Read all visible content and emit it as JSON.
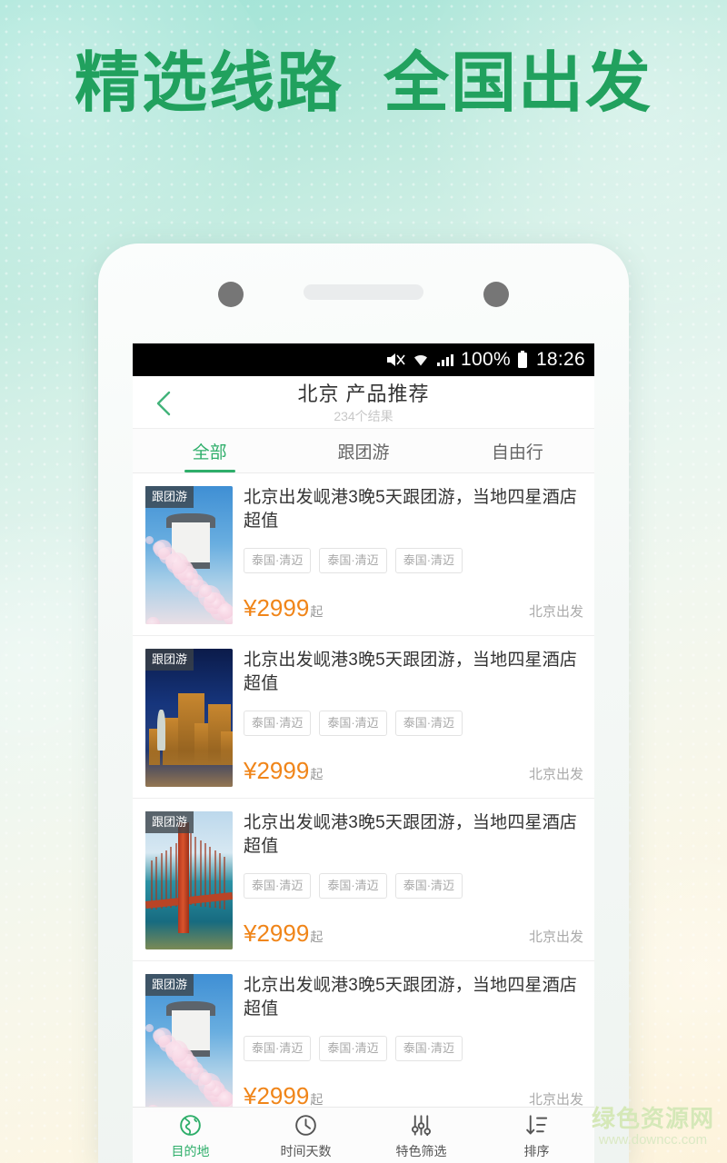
{
  "promo": {
    "headline": "精选线路  全国出发"
  },
  "status_bar": {
    "mute_icon": "mute-icon",
    "wifi_icon": "wifi-icon",
    "signal_icon": "signal-icon",
    "battery_percent": "100%",
    "battery_icon": "battery-icon",
    "time": "18:26"
  },
  "header": {
    "back_icon": "back-chevron-icon",
    "title": "北京 产品推荐",
    "result_count": "234个结果"
  },
  "tabs": [
    {
      "label": "全部",
      "active": true
    },
    {
      "label": "跟团游",
      "active": false
    },
    {
      "label": "自由行",
      "active": false
    }
  ],
  "products": [
    {
      "badge": "跟团游",
      "title": "北京出发岘港3晚5天跟团游，当地四星酒店超值",
      "tags": [
        "泰国·清迈",
        "泰国·清迈",
        "泰国·清迈"
      ],
      "price_symbol": "¥",
      "price": "2999",
      "price_suffix": "起",
      "depart": "北京出发",
      "image": "cherry-blossom-castle"
    },
    {
      "badge": "跟团游",
      "title": "北京出发岘港3晚5天跟团游，当地四星酒店超值",
      "tags": [
        "泰国·清迈",
        "泰国·清迈",
        "泰国·清迈"
      ],
      "price_symbol": "¥",
      "price": "2999",
      "price_suffix": "起",
      "depart": "北京出发",
      "image": "las-vegas-night"
    },
    {
      "badge": "跟团游",
      "title": "北京出发岘港3晚5天跟团游，当地四星酒店超值",
      "tags": [
        "泰国·清迈",
        "泰国·清迈",
        "泰国·清迈"
      ],
      "price_symbol": "¥",
      "price": "2999",
      "price_suffix": "起",
      "depart": "北京出发",
      "image": "golden-gate-bridge"
    },
    {
      "badge": "跟团游",
      "title": "北京出发岘港3晚5天跟团游，当地四星酒店超值",
      "tags": [
        "泰国·清迈",
        "泰国·清迈",
        "泰国·清迈"
      ],
      "price_symbol": "¥",
      "price": "2999",
      "price_suffix": "起",
      "depart": "北京出发",
      "image": "cherry-blossom-castle"
    }
  ],
  "bottom_nav": [
    {
      "label": "目的地",
      "icon": "globe-icon",
      "active": true
    },
    {
      "label": "时间天数",
      "icon": "clock-icon",
      "active": false
    },
    {
      "label": "特色筛选",
      "icon": "sliders-icon",
      "active": false
    },
    {
      "label": "排序",
      "icon": "sort-icon",
      "active": false
    }
  ],
  "watermark": {
    "name": "绿色资源网",
    "url": "www.downcc.com"
  },
  "colors": {
    "brand_green": "#2eae6a",
    "headline_green": "#21a15e",
    "price_orange": "#f08519",
    "watermark_green": "#d5e8b8"
  }
}
